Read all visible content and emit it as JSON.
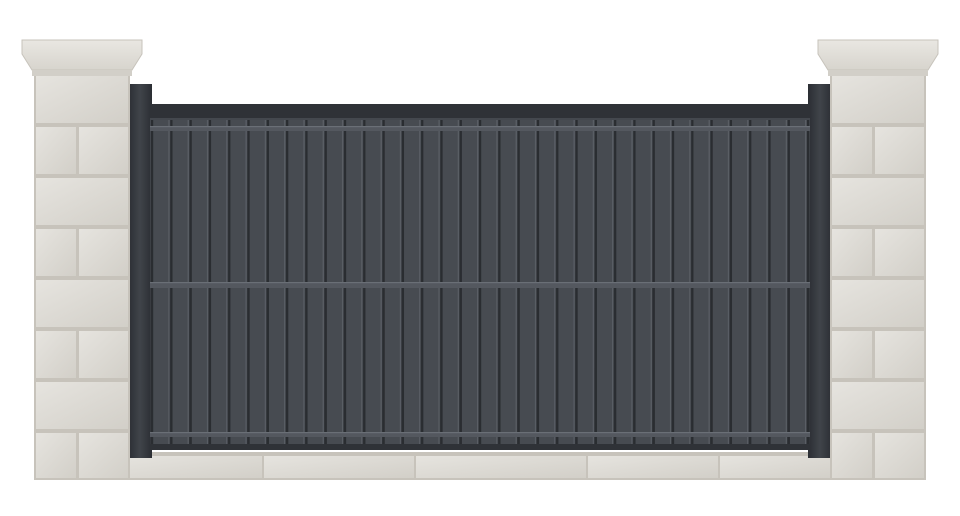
{
  "scene": {
    "subject": "gate-with-stone-pillars",
    "gate": {
      "panel_color": "#3a3d42",
      "slat_color": "#474b51",
      "slat_highlight": "#6a6f76",
      "frame_color": "#2d3035",
      "rail_color": "#54585f",
      "post_color": "#34373c"
    },
    "stone": {
      "block_color": "#e6e4df",
      "block_shade": "#d2cfc8",
      "mortar_color": "#c7c3bb",
      "cap_color": "#e9e7e2",
      "cap_shade": "#d7d4cd"
    },
    "background": "#ffffff"
  }
}
